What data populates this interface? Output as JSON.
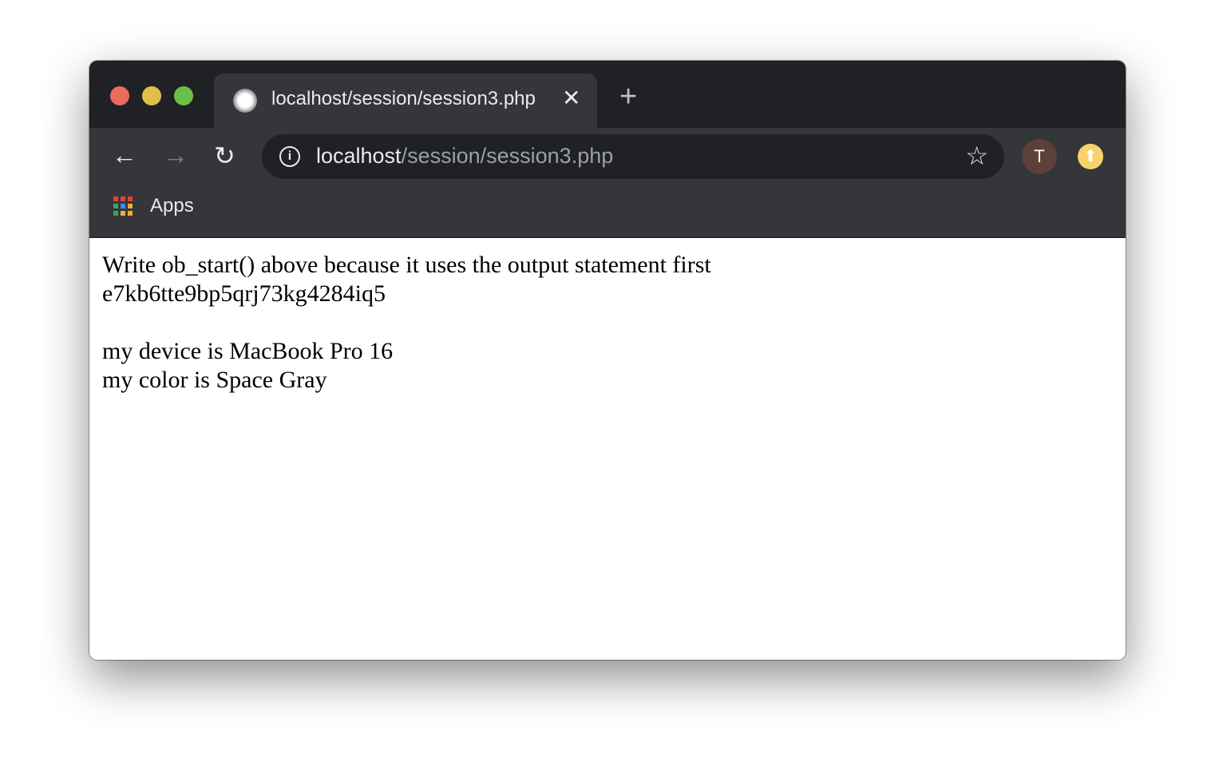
{
  "tab": {
    "title": "localhost/session/session3.php",
    "favicon": "server-icon"
  },
  "address": {
    "host": "localhost",
    "path": "/session/session3.php"
  },
  "profile": {
    "initial": "T",
    "color": "#5d4037"
  },
  "update_color": "#f9d26b",
  "bookmarks": {
    "apps_label": "Apps"
  },
  "content": {
    "lines": [
      "Write ob_start() above because it uses the output statement first",
      "e7kb6tte9bp5qrj73kg4284iq5",
      "",
      "my device is MacBook Pro 16",
      "my color is Space Gray"
    ]
  }
}
